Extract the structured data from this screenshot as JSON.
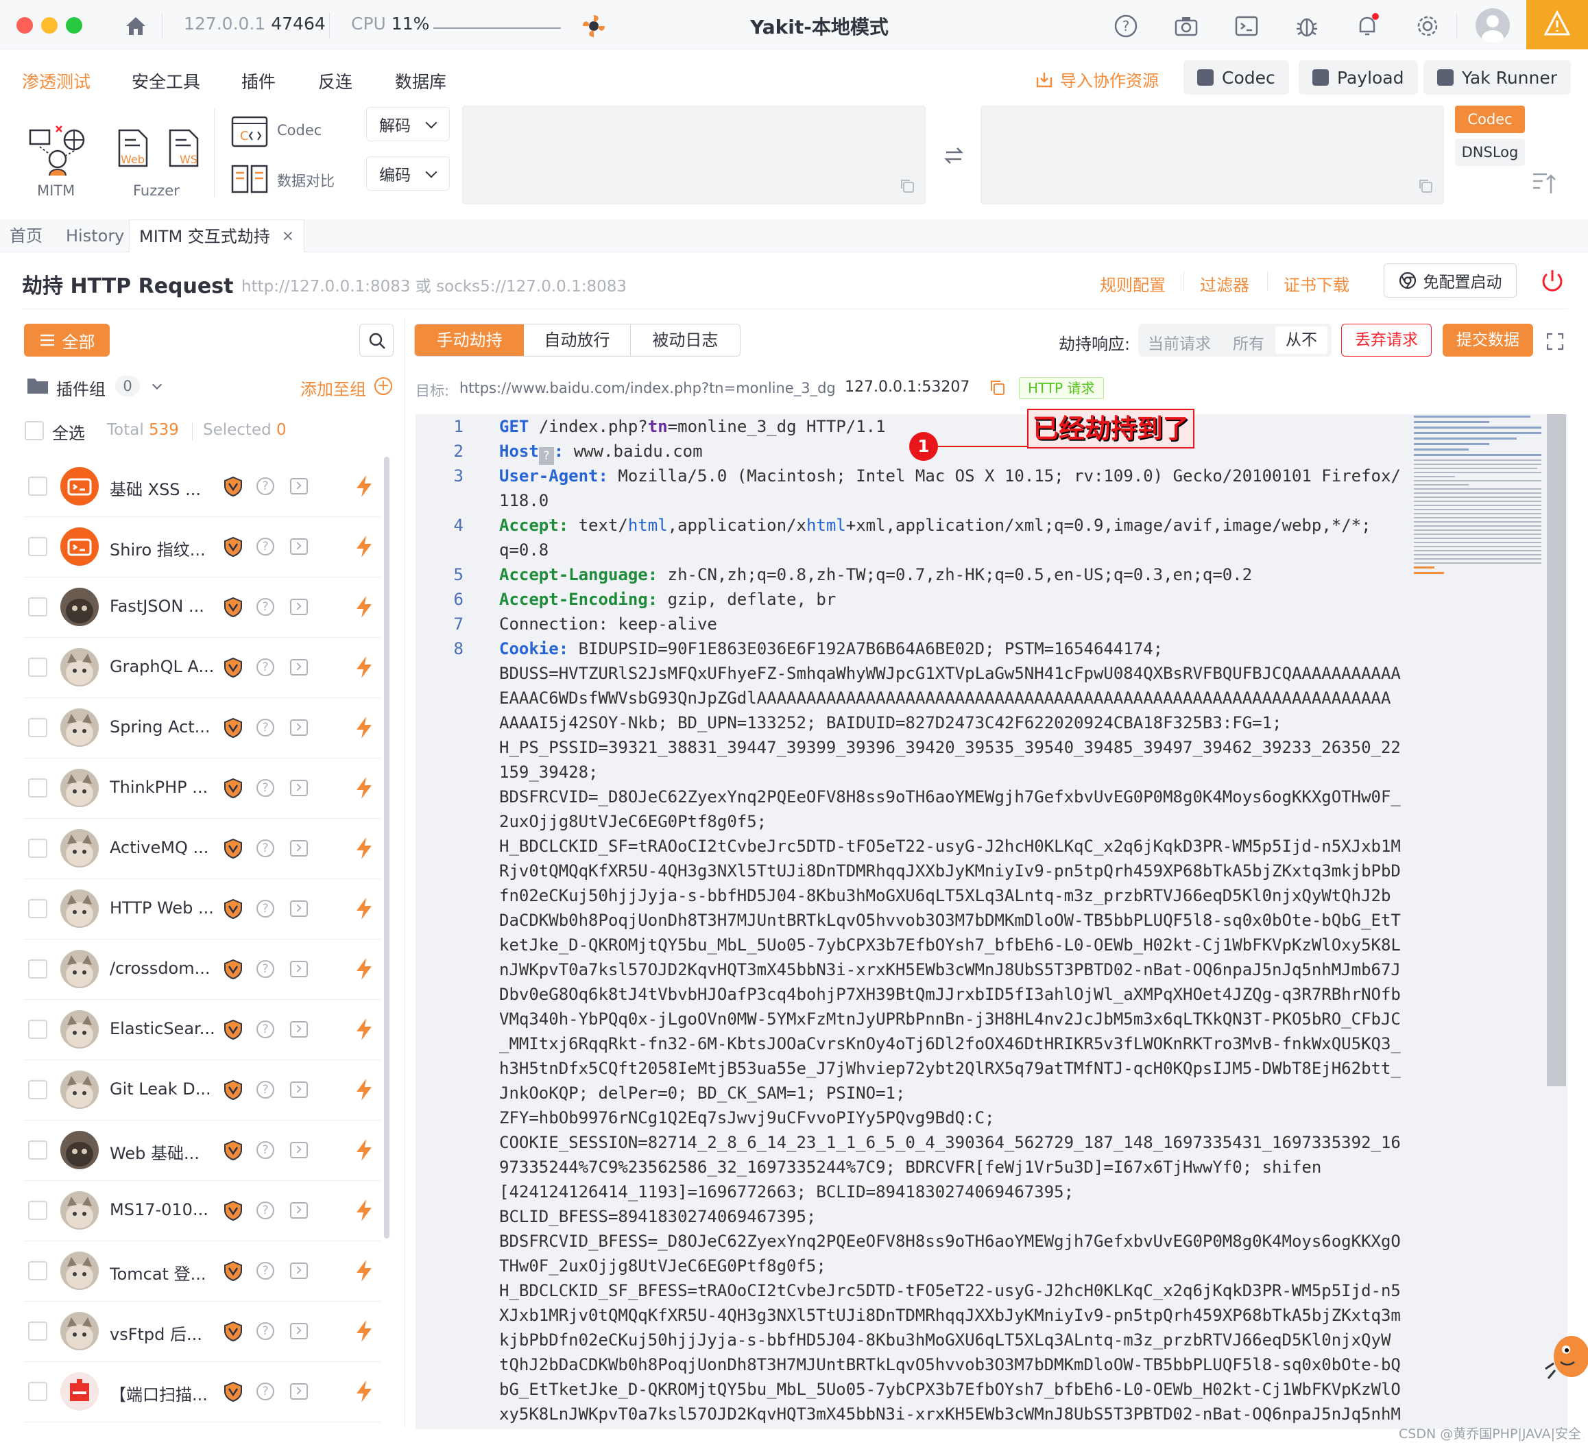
{
  "titlebar": {
    "host": "127.0.0.1",
    "port": "47464",
    "cpu_label": "CPU",
    "cpu_value": "11%",
    "title": "Yakit-本地模式"
  },
  "menu": {
    "items": [
      "渗透测试",
      "安全工具",
      "插件",
      "反连",
      "数据库"
    ],
    "import_label": "导入协作资源",
    "buttons": [
      "Codec",
      "Payload",
      "Yak Runner"
    ]
  },
  "toolbox": {
    "mitm_label": "MITM",
    "fuzzer_label": "Fuzzer",
    "web_label": "Web",
    "ws_label": "WS",
    "codec_label": "Codec",
    "compare_label": "数据对比",
    "decode_label": "解码",
    "encode_label": "编码",
    "side_tabs": [
      "Codec",
      "DNSLog"
    ]
  },
  "tabs": [
    "首页",
    "History",
    "MITM 交互式劫持"
  ],
  "header": {
    "title": "劫持 HTTP Request",
    "proxy": "http://127.0.0.1:8083 或 socks5://127.0.0.1:8083",
    "links": [
      "规则配置",
      "过滤器",
      "证书下载"
    ],
    "start_btn": "免配置启动"
  },
  "left": {
    "all_btn": "全部",
    "group_label": "插件组",
    "group_count": "0",
    "add_to": "添加至组",
    "select_all": "全选",
    "total_label": "Total",
    "total_value": "539",
    "selected_label": "Selected",
    "selected_value": "0",
    "plugins": [
      {
        "name": "基础 XSS ...",
        "avatar": "orange"
      },
      {
        "name": "Shiro 指纹...",
        "avatar": "orange"
      },
      {
        "name": "FastJSON ...",
        "avatar": "dark"
      },
      {
        "name": "GraphQL A...",
        "avatar": "cat"
      },
      {
        "name": "Spring Act...",
        "avatar": "cat"
      },
      {
        "name": "ThinkPHP ...",
        "avatar": "cat"
      },
      {
        "name": "ActiveMQ ...",
        "avatar": "cat"
      },
      {
        "name": "HTTP Web ...",
        "avatar": "cat"
      },
      {
        "name": "/crossdom...",
        "avatar": "cat"
      },
      {
        "name": "ElasticSear...",
        "avatar": "cat"
      },
      {
        "name": "Git Leak D...",
        "avatar": "cat"
      },
      {
        "name": "Web 基础...",
        "avatar": "dark"
      },
      {
        "name": "MS17-010...",
        "avatar": "cat"
      },
      {
        "name": "Tomcat 登...",
        "avatar": "cat"
      },
      {
        "name": "vsFtpd 后...",
        "avatar": "cat"
      },
      {
        "name": "【端口扫描...",
        "avatar": "red"
      }
    ]
  },
  "controls": {
    "modes": [
      "手动劫持",
      "自动放行",
      "被动日志"
    ],
    "resp_label": "劫持响应:",
    "resp_opts": [
      "当前请求",
      "所有",
      "从不"
    ],
    "drop_btn": "丢弃请求",
    "submit_btn": "提交数据",
    "target_label": "目标:",
    "target_url": "https://www.baidu.com/index.php?tn=monline_3_dg",
    "target_addr": "127.0.0.1:53207",
    "badge": "HTTP 请求"
  },
  "annotation": {
    "num": "1",
    "text": "已经劫持到了"
  },
  "watermark": "CSDN @黄乔国PHP|JAVA|安全",
  "request": {
    "line1": {
      "method": "GET",
      "path": "/index.php?",
      "param": "tn",
      "value": "=monline_3_dg",
      "proto": "HTTP/1.1"
    },
    "host_key": "Host",
    "host_val": "www.baidu.com",
    "ua_key": "User-Agent:",
    "ua_val": "Mozilla/5.0 (Macintosh; Intel Mac OS X 10.15; rv:109.0) Gecko/20100101 Firefox/",
    "ua_val2": "118.0",
    "accept_key": "Accept:",
    "accept_val_a": "text/",
    "accept_html": "html",
    "accept_val_b": ",application/x",
    "accept_xhtml": "html",
    "accept_val_c": "+xml,application/xml;q=0.9,image/avif,image/webp,*/*;",
    "accept_val2": "q=0.8",
    "lang_key": "Accept-Language:",
    "lang_val": "zh-CN,zh;q=0.8,zh-TW;q=0.7,zh-HK;q=0.5,en-US;q=0.3,en;q=0.2",
    "enc_key": "Accept-Encoding:",
    "enc_val": "gzip, deflate, br",
    "conn_line": "Connection: keep-alive",
    "cookie_key": "Cookie:",
    "cookie_first": "BIDUPSID=90F1E863E036E6F192A7B6B64A6BE02D; PSTM=1654644174;",
    "cookie_lines": [
      "BDUSS=HVTZURlS2JsMFQxUFhyeFZ-SmhqaWhyWWJpcG1XTVpLaGw5NH41cFpwU084QXBsRVFBQUFBJCQAAAAAAAAAAA",
      "EAAAC6WDsfWWVsbG93QnJpZGdlAAAAAAAAAAAAAAAAAAAAAAAAAAAAAAAAAAAAAAAAAAAAAAAAAAAAAAAAAAAAAAAA",
      "AAAAI5j42SOY-Nkb; BD_UPN=133252; BAIDUID=827D2473C42F622020924CBA18F325B3:FG=1;",
      "H_PS_PSSID=39321_38831_39447_39399_39396_39420_39535_39540_39485_39497_39462_39233_26350_22",
      "159_39428;",
      "BDSFRCVID=_D8OJeC62ZyexYnq2PQEeOFV8H8ss9oTH6aoYMEWgjh7GefxbvUvEG0P0M8g0K4Moys6ogKKXgOTHw0F_",
      "2uxOjjg8UtVJeC6EG0Ptf8g0f5;",
      "H_BDCLCKID_SF=tRAOoCI2tCvbeJrc5DTD-tFO5eT22-usyG-J2hcH0KLKqC_x2q6jKqkD3PR-WM5p5Ijd-n5XJxb1M",
      "Rjv0tQMQqKfXR5U-4QH3g3NXl5TtUJi8DnTDMRhqqJXXbJyKMniyIv9-pn5tpQrh459XP68bTkA5bjZKxtq3mkjbPbD",
      "fn02eCKuj50hjjJyja-s-bbfHD5J04-8Kbu3hMoGXU6qLT5XLq3ALntq-m3z_przbRTVJ66eqD5Kl0njxQyWtQhJ2b",
      "DaCDKWb0h8PoqjUonDh8T3H7MJUntBRTkLqvO5hvvob3O3M7bDMKmDloOW-TB5bbPLUQF5l8-sq0x0bOte-bQbG_EtT",
      "ketJke_D-QKROMjtQY5bu_MbL_5Uo05-7ybCPX3b7EfbOYsh7_bfbEh6-L0-OEWb_H02kt-Cj1WbFKVpKzWlOxy5K8L",
      "nJWKpvT0a7ksl57OJD2KqvHQT3mX45bbN3i-xrxKH5EWb3cWMnJ8UbS5T3PBTD02-nBat-OQ6npaJ5nJq5nhMJmb67J",
      "Dbv0eG8Oq6k8tJ4tVbvbHJOafP3cq4bohjP7XH39BtQmJJrxbID5fI3ahlOjWl_aXMPqXHOet4JZQg-q3R7RBhrNOfb",
      "VMq340h-YbPQq0x-jLgoOVn0MW-5YMxFzMtnJyUPRbPnnBn-j3H8HL4nv2JcJbM5m3x6qLTKkQN3T-PKO5bRO_CFbJC",
      "_MMItxj6RqqRkt-fn32-6M-KbtsJOOaCvrsKnOy4oTj6Dl2foOX46DtHRIKR5v3fLWOKnRKTro3MvB-fnkWxQU5KQ3_",
      "h3H5tnDfx5CQft2058IeMtjB53ua55e_J7jWhviep72ybt2QlRX5q79atTMfNTJ-qcH0KQpsIJM5-DWbT8EjH62btt_",
      "JnkOoKQP; delPer=0; BD_CK_SAM=1; PSINO=1;",
      "ZFY=hbOb9976rNCg1Q2Eq7sJwvj9uCFvvoPIYy5PQvg9BdQ:C;",
      "COOKIE_SESSION=82714_2_8_6_14_23_1_1_6_5_0_4_390364_562729_187_148_1697335431_1697335392_16",
      "97335244%7C9%23562586_32_1697335244%7C9; BDRCVFR[feWj1Vr5u3D]=I67x6TjHwwYf0; shifen",
      "[424124126414_1193]=1696772663; BCLID=8941830274069467395;",
      "BCLID_BFESS=8941830274069467395;",
      "BDSFRCVID_BFESS=_D8OJeC62ZyexYnq2PQEeOFV8H8ss9oTH6aoYMEWgjh7GefxbvUvEG0P0M8g0K4Moys6ogKKXgO",
      "THw0F_2uxOjjg8UtVJeC6EG0Ptf8g0f5;",
      "H_BDCLCKID_SF_BFESS=tRAOoCI2tCvbeJrc5DTD-tFO5eT22-usyG-J2hcH0KLKqC_x2q6jKqkD3PR-WM5p5Ijd-n5",
      "XJxb1MRjv0tQMQqKfXR5U-4QH3g3NXl5TtUJi8DnTDMRhqqJXXbJyKMniyIv9-pn5tpQrh459XP68bTkA5bjZKxtq3m",
      "kjbPbDfn02eCKuj50hjjJyja-s-bbfHD5J04-8Kbu3hMoGXU6qLT5XLq3ALntq-m3z_przbRTVJ66eqD5Kl0njxQyW",
      "tQhJ2bDaCDKWb0h8PoqjUonDh8T3H7MJUntBRTkLqvO5hvvob3O3M7bDMKmDloOW-TB5bbPLUQF5l8-sq0x0bOte-bQ",
      "bG_EtTketJke_D-QKROMjtQY5bu_MbL_5Uo05-7ybCPX3b7EfbOYsh7_bfbEh6-L0-OEWb_H02kt-Cj1WbFKVpKzWlO",
      "xy5K8LnJWKpvT0a7ksl57OJD2KqvHQT3mX45bbN3i-xrxKH5EWb3cWMnJ8UbS5T3PBTD02-nBat-OQ6npaJ5nJq5nhM"
    ]
  }
}
